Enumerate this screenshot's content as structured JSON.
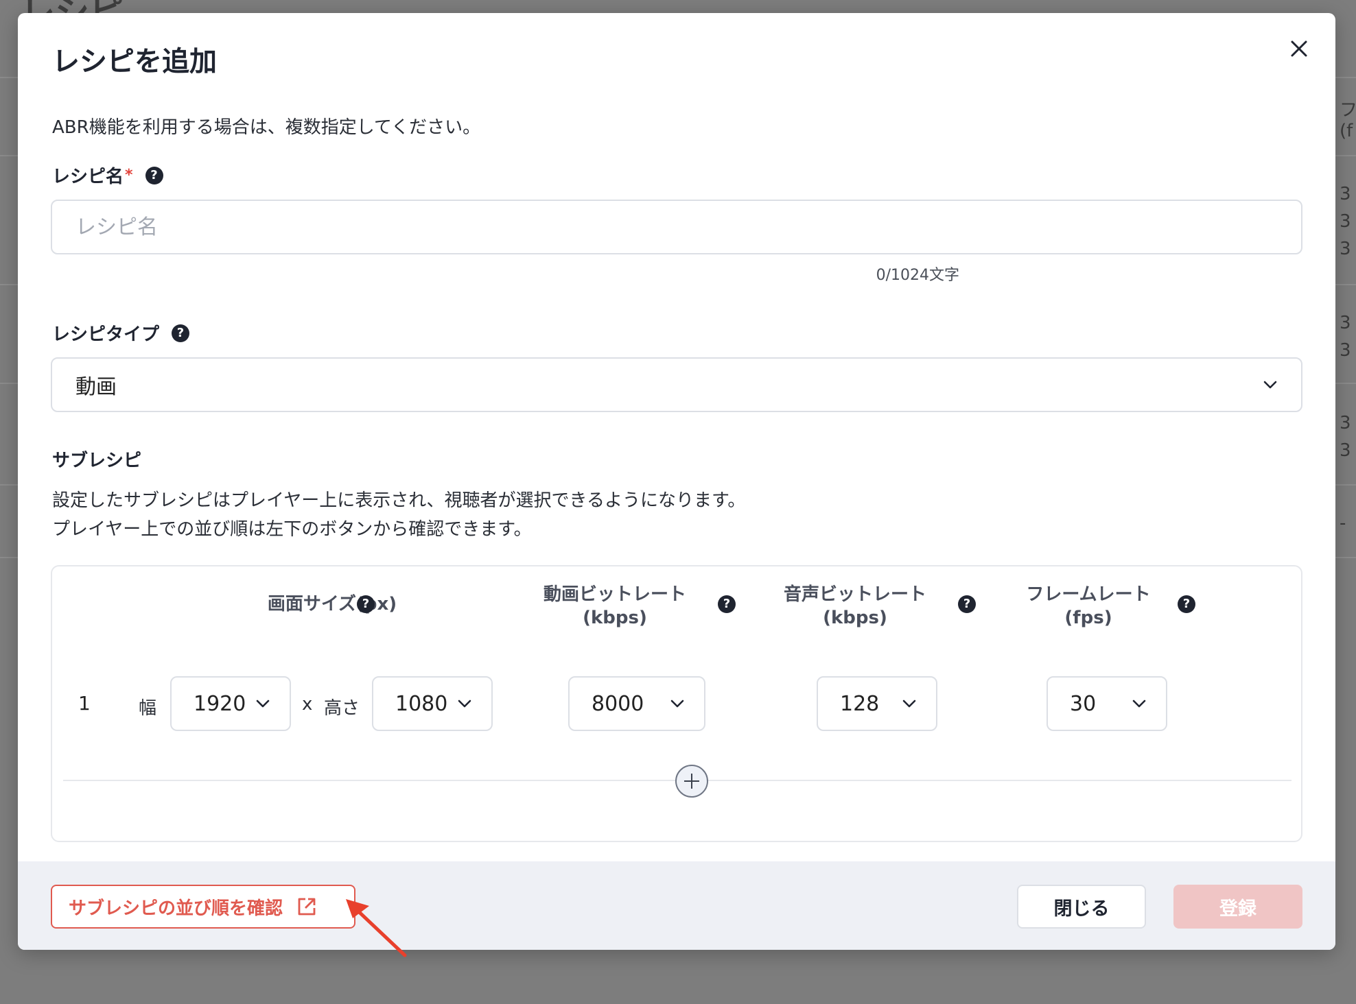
{
  "background": {
    "page_title": "レシピ",
    "right_edge_texts": [
      "フ",
      "(f",
      "3",
      "3",
      "3",
      "3",
      "3",
      "3",
      "3",
      "-"
    ]
  },
  "modal": {
    "title": "レシピを追加",
    "description": "ABR機能を利用する場合は、複数指定してください。",
    "recipe_name": {
      "label": "レシピ名",
      "required_mark": "*",
      "placeholder": "レシピ名",
      "value": "",
      "char_count": "0/1024文字"
    },
    "recipe_type": {
      "label": "レシピタイプ",
      "selected": "動画"
    },
    "sub_recipe": {
      "title": "サブレシピ",
      "description_line1": "設定したサブレシピはプレイヤー上に表示され、視聴者が選択できるようになります。",
      "description_line2": "プレイヤー上での並び順は左下のボタンから確認できます。",
      "columns": {
        "screen_size": "画面サイズ(px)",
        "video_bitrate_line1": "動画ビットレート",
        "video_bitrate_line2": "(kbps)",
        "audio_bitrate_line1": "音声ビットレート",
        "audio_bitrate_line2": "(kbps)",
        "frame_rate_line1": "フレームレート",
        "frame_rate_line2": "(fps)"
      },
      "rows": [
        {
          "index": "1",
          "width_label": "幅",
          "width": "1920",
          "separator": "x",
          "height_label": "高さ",
          "height": "1080",
          "video_bitrate": "8000",
          "audio_bitrate": "128",
          "frame_rate": "30"
        }
      ]
    },
    "footer": {
      "order_button": "サブレシピの並び順を確認",
      "close_button": "閉じる",
      "submit_button": "登録"
    }
  },
  "colors": {
    "accent_red": "#e05a4f",
    "submit_disabled": "#f0c5c5",
    "overlay": "#7d7d7d",
    "annotation_arrow": "#e8402c"
  },
  "icons": [
    "help-icon",
    "close-icon",
    "chevron-down-icon",
    "plus-icon",
    "external-link-icon",
    "arrow-annotation"
  ]
}
